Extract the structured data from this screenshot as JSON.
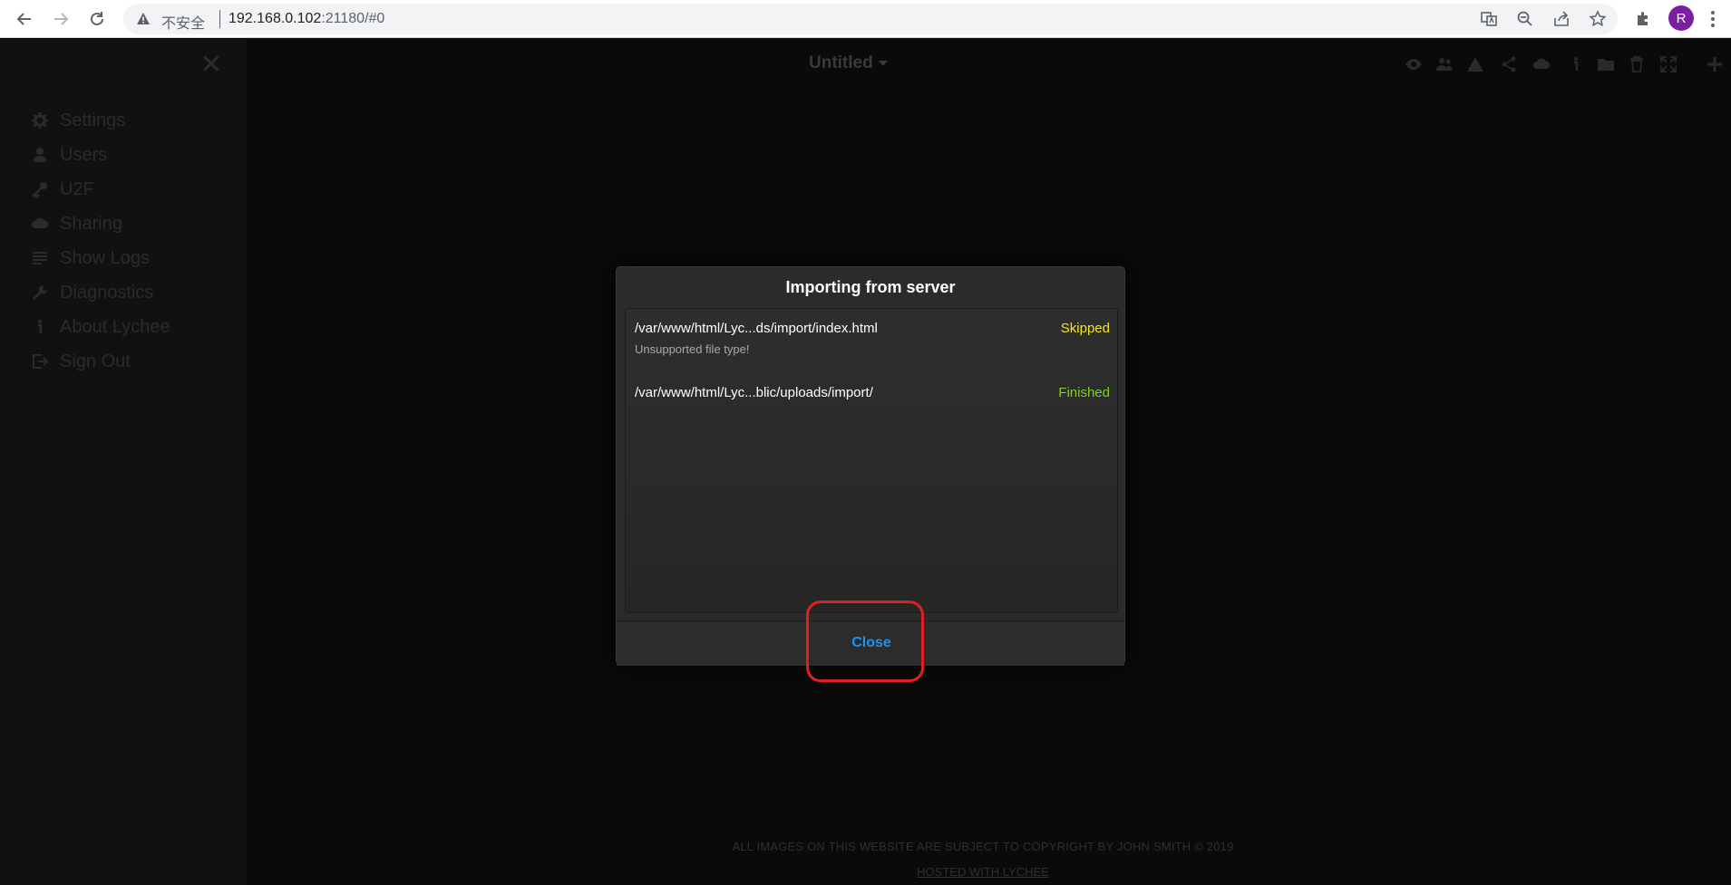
{
  "browser": {
    "security_label": "不安全",
    "url_host": "192.168.0.102",
    "url_rest": ":21180/#0",
    "profile_initial": "R",
    "icons": [
      "back-icon",
      "forward-icon",
      "reload-icon",
      "warning-icon",
      "translate-icon",
      "zoom-out-icon",
      "share-icon",
      "star-icon",
      "extensions-icon",
      "more-icon"
    ]
  },
  "sidebar": {
    "items": [
      {
        "label": "Settings",
        "icon": "gear-icon"
      },
      {
        "label": "Users",
        "icon": "user-icon"
      },
      {
        "label": "U2F",
        "icon": "key-icon"
      },
      {
        "label": "Sharing",
        "icon": "cloud-icon"
      },
      {
        "label": "Show Logs",
        "icon": "list-icon"
      },
      {
        "label": "Diagnostics",
        "icon": "wrench-icon"
      },
      {
        "label": "About Lychee",
        "icon": "info-icon"
      },
      {
        "label": "Sign Out",
        "icon": "sign-out-icon"
      }
    ]
  },
  "header": {
    "title": "Untitled",
    "toolbar_icons": [
      "eye-icon",
      "users-icon",
      "warning-icon",
      "share-icon",
      "upload-icon",
      "info-icon",
      "folder-icon",
      "trash-icon",
      "fullscreen-icon",
      "plus-icon"
    ]
  },
  "dialog": {
    "title": "Importing from server",
    "rows": [
      {
        "path": "/var/www/html/Lyc...ds/import/index.html",
        "status": "Skipped",
        "note": "Unsupported file type!"
      },
      {
        "path": "/var/www/html/Lyc...blic/uploads/import/",
        "status": "Finished",
        "note": ""
      }
    ],
    "close_label": "Close"
  },
  "footer": {
    "copyright": "ALL IMAGES ON THIS WEBSITE ARE SUBJECT TO COPYRIGHT BY JOHN SMITH © 2019",
    "hosted": "HOSTED WITH LYCHEE"
  },
  "colors": {
    "skipped": "#f5e425",
    "finished": "#7ed321",
    "accent": "#2293ec",
    "highlight": "#e02020"
  }
}
